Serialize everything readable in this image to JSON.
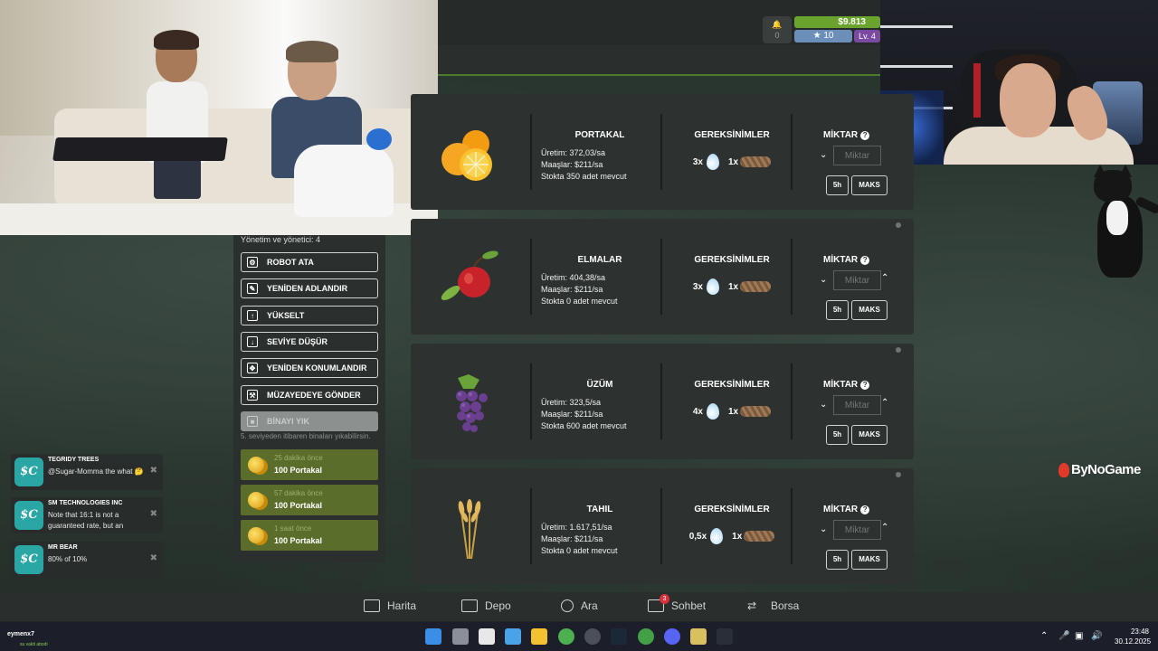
{
  "header": {
    "money": "$9.813",
    "stars": "10",
    "level": "Lv. 4",
    "notif_count": "0"
  },
  "building": {
    "management_label": "Yönetim ve yönetici: 4",
    "actions": [
      {
        "label": "ROBOT ATA",
        "icon": "robot-icon",
        "enabled": true
      },
      {
        "label": "YENİDEN ADLANDIR",
        "icon": "edit-icon",
        "enabled": true
      },
      {
        "label": "YÜKSELT",
        "icon": "upgrade-arrow-icon",
        "enabled": true
      },
      {
        "label": "SEVİYE DÜŞÜR",
        "icon": "downgrade-arrow-icon",
        "enabled": true
      },
      {
        "label": "YENİDEN KONUMLANDIR",
        "icon": "move-icon",
        "enabled": true
      },
      {
        "label": "MÜZAYEDEYE GÖNDER",
        "icon": "gavel-icon",
        "enabled": true
      },
      {
        "label": "BİNAYI YIK",
        "icon": "demolish-icon",
        "enabled": false
      }
    ],
    "demolish_note": "5. seviyeden itibaren binaları yıkabilirsin.",
    "history": [
      {
        "ago": "25 dakika önce",
        "amount": "100 Portakal"
      },
      {
        "ago": "57 dakika önce",
        "amount": "100 Portakal"
      },
      {
        "ago": "1 saat önce",
        "amount": "100 Portakal"
      }
    ]
  },
  "labels": {
    "requirements": "GEREKSİNİMLER",
    "quantity": "MİKTAR",
    "quantity_placeholder": "Miktar",
    "btn_5h": "5h",
    "btn_max": "MAKS"
  },
  "products": [
    {
      "name": "PORTAKAL",
      "production": "Üretim: 372,03/sa",
      "wages": "Maaşlar: $211/sa",
      "stock": "Stokta 350 adet mevcut",
      "water": "3x",
      "seeds": "1x",
      "icon": "orange-icon"
    },
    {
      "name": "ELMALAR",
      "production": "Üretim: 404,38/sa",
      "wages": "Maaşlar: $211/sa",
      "stock": "Stokta 0 adet mevcut",
      "water": "3x",
      "seeds": "1x",
      "icon": "apple-icon"
    },
    {
      "name": "ÜZÜM",
      "production": "Üretim: 323,5/sa",
      "wages": "Maaşlar: $211/sa",
      "stock": "Stokta 600 adet mevcut",
      "water": "4x",
      "seeds": "1x",
      "icon": "grape-icon"
    },
    {
      "name": "TAHIL",
      "production": "Üretim: 1.617,51/sa",
      "wages": "Maaşlar: $211/sa",
      "stock": "Stokta 0 adet mevcut",
      "water": "0,5x",
      "seeds": "1x",
      "icon": "wheat-icon"
    }
  ],
  "chat": [
    {
      "name": "TEGRIDY TREES",
      "message": "@Sugar-Momma the what 🤔",
      "logo": "$C"
    },
    {
      "name": "SM TECHNOLOGIES INC",
      "message": "Note that 16:1 is not a guaranteed rate, but an",
      "logo": "$C"
    },
    {
      "name": "MR BEAR",
      "message": "80% of 10%",
      "logo": "$C"
    }
  ],
  "nav": [
    {
      "label": "Harita",
      "icon": "map-icon"
    },
    {
      "label": "Depo",
      "icon": "warehouse-icon"
    },
    {
      "label": "Ara",
      "icon": "search-icon"
    },
    {
      "label": "Sohbet",
      "icon": "chat-icon",
      "badge": "3"
    },
    {
      "label": "Borsa",
      "icon": "exchange-icon"
    }
  ],
  "overlay": {
    "brand": "ByNoGame"
  },
  "taskbar": {
    "user": "eymenx7",
    "user_status": "su vakti abodi",
    "time": "23:48",
    "date": "30.12.2025"
  }
}
